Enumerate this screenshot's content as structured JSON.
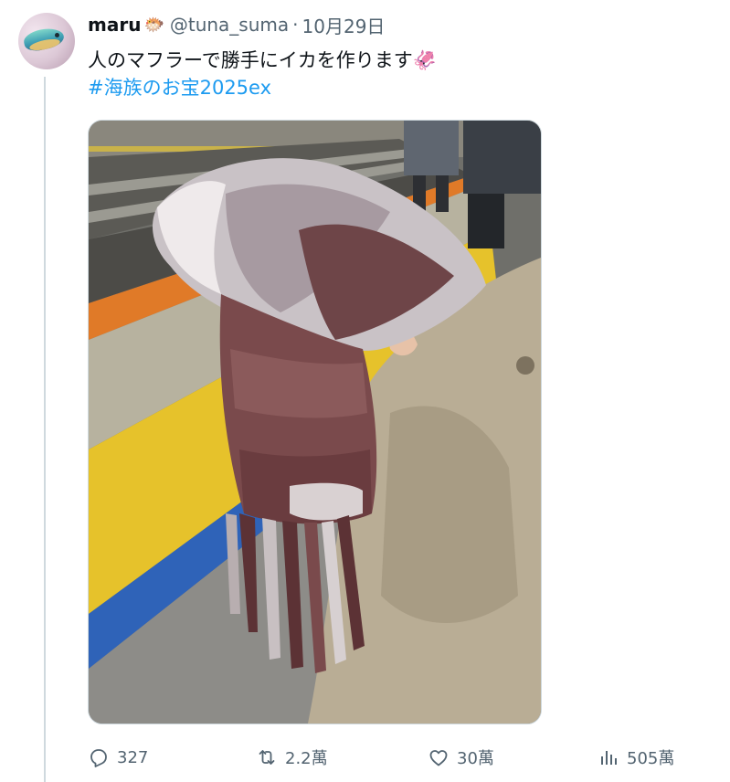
{
  "author": {
    "display_name": "maru",
    "name_emoji": "🐡",
    "handle": "@tuna_suma",
    "separator": "·",
    "date": "10月29日"
  },
  "tweet": {
    "text": "人のマフラーで勝手にイカを作ります",
    "text_emoji": "🦑",
    "hashtag": "#海族のお宝2025ex"
  },
  "actions": {
    "replies": "327",
    "retweets": "2.2萬",
    "likes": "30萬",
    "views": "505萬"
  },
  "colors": {
    "accent": "#1d9bf0",
    "secondary_text": "#536471",
    "primary_text": "#0f1419"
  },
  "icons": {
    "reply": "reply-icon",
    "retweet": "retweet-icon",
    "like": "heart-icon",
    "views": "views-icon"
  }
}
